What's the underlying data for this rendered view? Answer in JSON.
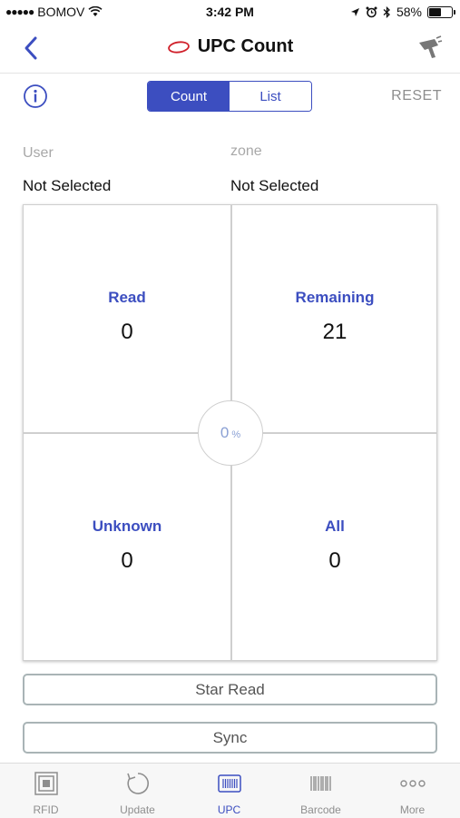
{
  "status_bar": {
    "carrier": "BOMOV",
    "time": "3:42 PM",
    "battery": "58%",
    "battery_level": 0.58
  },
  "navbar": {
    "title": "UPC Count",
    "logo_color": "#d0202a"
  },
  "toolbar": {
    "segments": [
      "Count",
      "List"
    ],
    "active_segment": "Count",
    "reset_label": "RESET"
  },
  "selection": {
    "user_label": "User",
    "user_value": "Not Selected",
    "zone_label": "zone",
    "zone_value": "Not Selected"
  },
  "counts": {
    "read": {
      "label": "Read",
      "value": "0"
    },
    "remaining": {
      "label": "Remaining",
      "value": "21"
    },
    "unknown": {
      "label": "Unknown",
      "value": "0"
    },
    "all": {
      "label": "All",
      "value": "0"
    },
    "percent": "0",
    "percent_symbol": "%"
  },
  "actions": {
    "star_read": "Star Read",
    "sync": "Sync"
  },
  "tabbar": {
    "items": [
      {
        "label": "RFID",
        "icon": "rfid-icon"
      },
      {
        "label": "Update",
        "icon": "update-icon"
      },
      {
        "label": "UPC",
        "icon": "upc-icon"
      },
      {
        "label": "Barcode",
        "icon": "barcode-icon"
      },
      {
        "label": "More",
        "icon": "more-icon"
      }
    ],
    "active": "UPC"
  },
  "colors": {
    "accent": "#3c4ec0",
    "muted": "#8e8e8e"
  }
}
